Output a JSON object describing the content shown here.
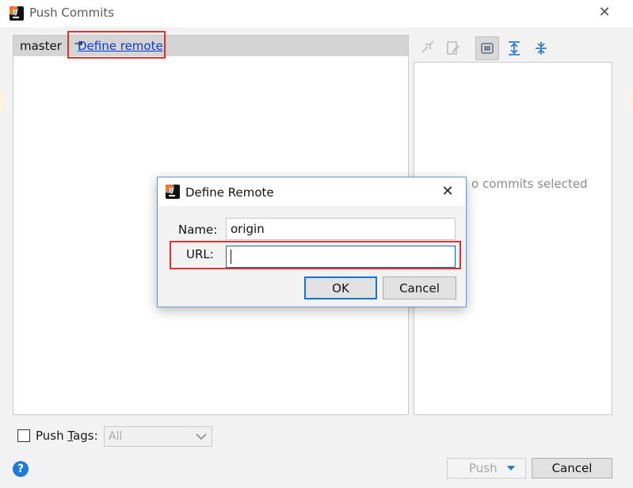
{
  "window": {
    "title": "Push Commits",
    "close_glyph": "✕",
    "logo_letters": "IJ"
  },
  "repo": {
    "branch": "master",
    "arrow": "→",
    "define_remote_link": "Define remote"
  },
  "toolbar": {
    "icons": [
      "fetch-icon",
      "edit-commit-icon",
      "toggle-details-icon",
      "expand-all-icon",
      "collapse-all-icon"
    ]
  },
  "commit_panel": {
    "empty_text": "o commits selected"
  },
  "footer": {
    "push_tags_prefix": "Push ",
    "push_tags_mnemonic": "T",
    "push_tags_suffix": "ags:",
    "tags_select_value": "All",
    "help_glyph": "?",
    "push_label": "Push",
    "cancel_label": "Cancel"
  },
  "modal": {
    "title": "Define Remote",
    "close_glyph": "✕",
    "name_label": "Name:",
    "name_value": "origin",
    "url_label": "URL:",
    "url_value": "",
    "ok_label": "OK",
    "cancel_label": "Cancel"
  },
  "colors": {
    "highlight": "#e53030",
    "link": "#0b39d6",
    "focus": "#0a67c9",
    "help": "#1e7ad8"
  }
}
